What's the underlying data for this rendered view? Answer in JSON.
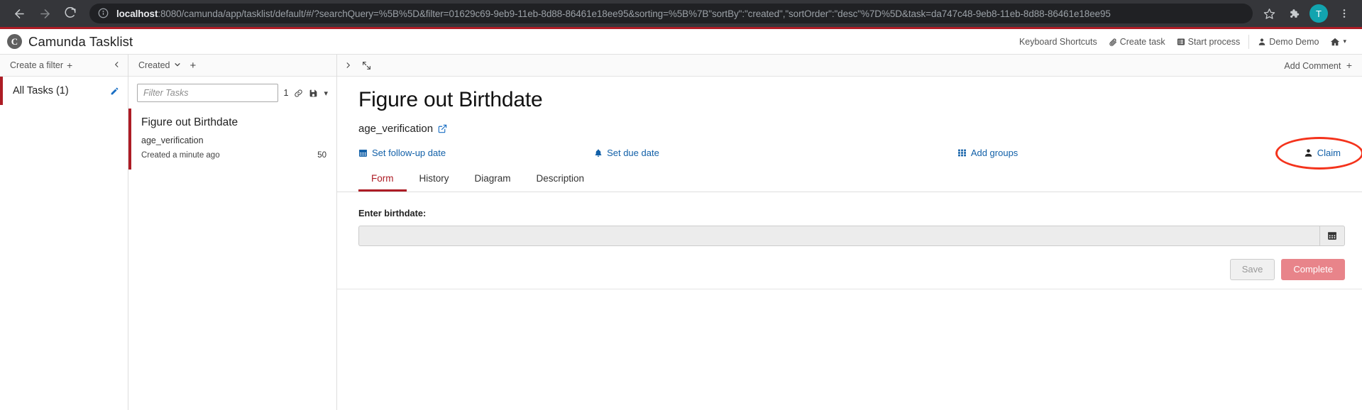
{
  "browser": {
    "back_icon": "arrow-left-icon",
    "forward_icon": "arrow-right-icon",
    "reload_icon": "reload-icon",
    "site_info_icon": "info-circle-icon",
    "url_host": "localhost",
    "url_path": ":8080/camunda/app/tasklist/default/#/?searchQuery=%5B%5D&filter=01629c69-9eb9-11eb-8d88-86461e18ee95&sorting=%5B%7B\"sortBy\":\"created\",\"sortOrder\":\"desc\"%7D%5D&task=da747c48-9eb8-11eb-8d88-86461e18ee95",
    "bookmark_icon": "star-icon",
    "extensions_icon": "puzzle-piece-icon",
    "profile_initial": "T",
    "menu_icon": "three-dots-vertical-icon"
  },
  "app_header": {
    "logo_letter": "C",
    "title": "Camunda Tasklist",
    "accent_color": "#ad1c25",
    "items": [
      {
        "label": "Keyboard Shortcuts",
        "icon": ""
      },
      {
        "label": "Create task",
        "icon": "paperclip-icon"
      },
      {
        "label": "Start process",
        "icon": "list-alt-icon"
      },
      {
        "label": "Demo Demo",
        "icon": "user-icon"
      }
    ],
    "home_icon": "home-icon",
    "home_caret": "▾"
  },
  "filters": {
    "create_label": "Create a filter",
    "create_plus": "+",
    "collapse_icon": "chevron-left-icon",
    "items": [
      {
        "label": "All Tasks (1)",
        "edit_icon": "pencil-icon",
        "selected": true
      }
    ]
  },
  "tasklist": {
    "sort_label": "Created",
    "sort_caret": "⌄",
    "add_sort": "+",
    "search_placeholder": "Filter Tasks",
    "search_value": "",
    "result_count": "1",
    "link_icon": "link-icon",
    "save_icon": "floppy-disk-icon",
    "save_caret": "▾",
    "tasks": [
      {
        "title": "Figure out Birthdate",
        "process": "age_verification",
        "created": "Created a minute ago",
        "priority": "50",
        "selected": true
      }
    ]
  },
  "detail": {
    "expand_left_icon": "chevron-right-icon",
    "expand_full_icon": "expand-arrows-icon",
    "add_comment_label": "Add Comment",
    "add_comment_plus": "+",
    "title": "Figure out Birthdate",
    "process_key": "age_verification",
    "process_external_icon": "external-link-icon",
    "actions": [
      {
        "label": "Set follow-up date",
        "icon": "calendar-icon"
      },
      {
        "label": "Set due date",
        "icon": "bell-icon"
      },
      {
        "label": "Add groups",
        "icon": "grid-icon"
      },
      {
        "label": "Claim",
        "icon": "user-solid-icon"
      }
    ],
    "tabs": [
      {
        "label": "Form",
        "active": true
      },
      {
        "label": "History",
        "active": false
      },
      {
        "label": "Diagram",
        "active": false
      },
      {
        "label": "Description",
        "active": false
      }
    ],
    "form": {
      "field_label": "Enter birthdate:",
      "field_value": "",
      "calendar_icon": "calendar-icon",
      "save_label": "Save",
      "complete_label": "Complete"
    }
  },
  "annotation": {
    "shape": "ellipse",
    "color": "#f4331c",
    "target": "Claim"
  }
}
